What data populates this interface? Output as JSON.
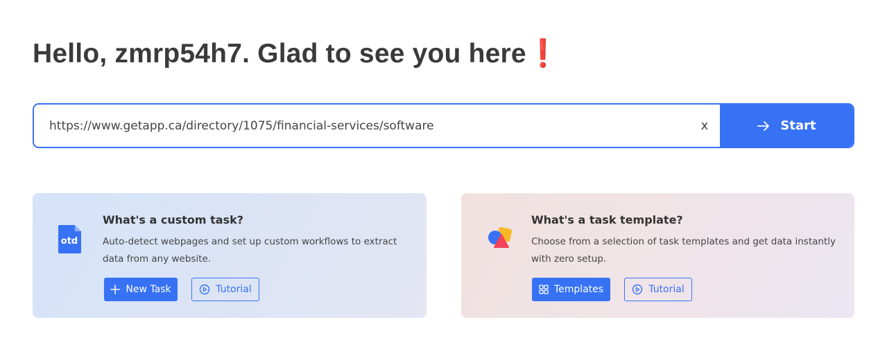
{
  "greeting": "Hello, zmrp54h7. Glad to see you here❗",
  "url_bar": {
    "value": "https://www.getapp.ca/directory/1075/financial-services/software",
    "clear_label": "x",
    "start_label": "Start"
  },
  "custom_task": {
    "icon_text": "otd",
    "title": "What's a custom task?",
    "description": "Auto-detect webpages and set up custom workflows to extract data from any website.",
    "primary_label": "New Task",
    "secondary_label": "Tutorial"
  },
  "task_template": {
    "title": "What's a task template?",
    "description": "Choose from a selection of task templates and get data instantly with zero setup.",
    "primary_label": "Templates",
    "secondary_label": "Tutorial"
  },
  "colors": {
    "accent": "#3772f5",
    "heading": "#3a3a3a"
  }
}
